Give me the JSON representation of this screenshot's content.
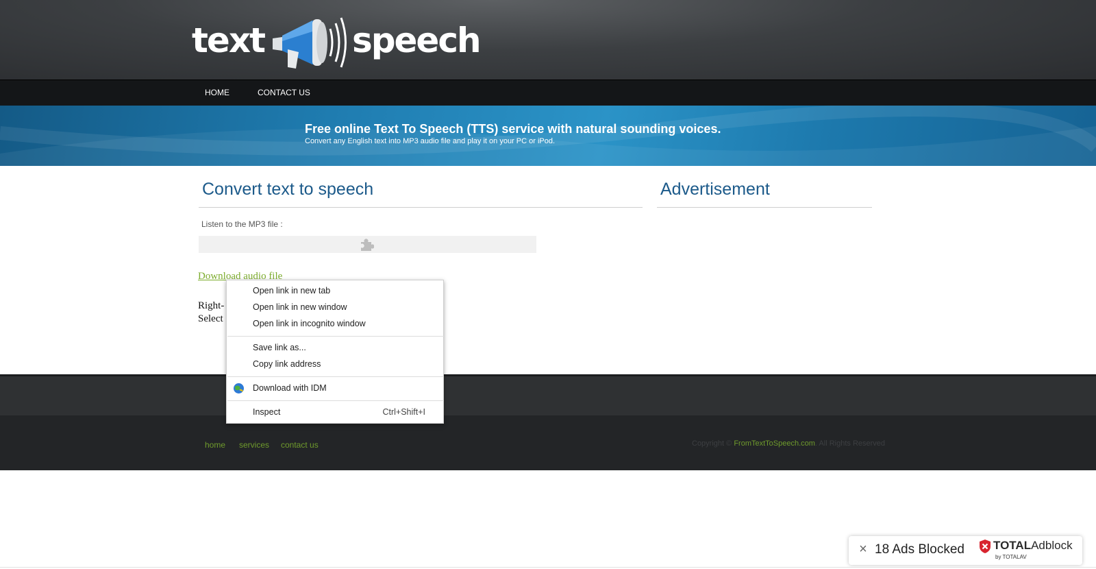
{
  "header": {
    "logo_left": "text",
    "logo_right": "speech"
  },
  "nav": {
    "items": [
      {
        "label": "HOME"
      },
      {
        "label": "CONTACT US"
      }
    ]
  },
  "banner": {
    "title": "Free online Text To Speech (TTS) service with natural sounding voices.",
    "subtitle": "Convert any English text into MP3 audio file and play it on your PC or iPod."
  },
  "main": {
    "title": "Convert text to speech",
    "mp3_label": "Listen to the MP3 file :",
    "download_link": "Download audio file",
    "line1_visible": "Right-",
    "line2_visible": "Select"
  },
  "sidebar": {
    "title": "Advertisement"
  },
  "footer": {
    "links": [
      {
        "label": "home"
      },
      {
        "label": "services"
      },
      {
        "label": "contact us"
      }
    ],
    "copyright_prefix": "Copyright ©",
    "copyright_site": "FromTextToSpeech.com",
    "copyright_suffix": ". All Rights Reserved"
  },
  "context_menu": {
    "items": [
      {
        "label": "Open link in new tab",
        "shortcut": ""
      },
      {
        "label": "Open link in new window",
        "shortcut": ""
      },
      {
        "label": "Open link in incognito window",
        "shortcut": ""
      },
      {
        "label": "Save link as...",
        "shortcut": ""
      },
      {
        "label": "Copy link address",
        "shortcut": ""
      },
      {
        "label": "Download with IDM",
        "shortcut": "",
        "icon": "idm-icon"
      },
      {
        "label": "Inspect",
        "shortcut": "Ctrl+Shift+I"
      }
    ]
  },
  "adblock": {
    "count_text": "18 Ads Blocked",
    "brand_bold": "TOTAL",
    "brand_light": "Adblock",
    "by_text": "by TOTALAV"
  },
  "colors": {
    "link_green": "#7bab2b",
    "title_blue": "#1c5a8a",
    "banner_blue": "#1f7cb0",
    "adblock_red": "#d8242f"
  }
}
